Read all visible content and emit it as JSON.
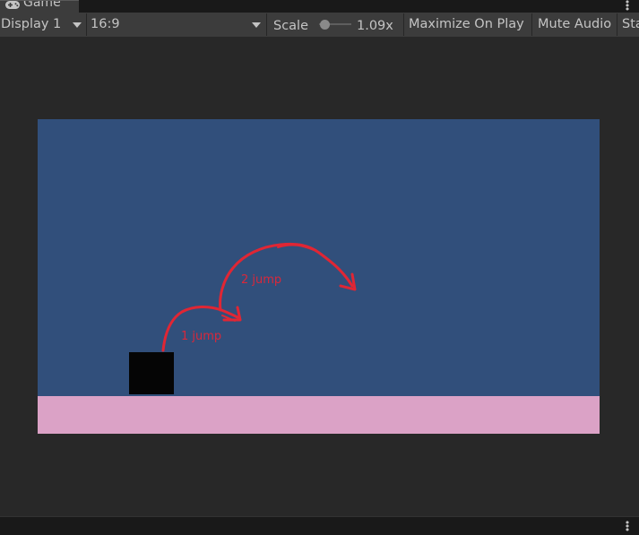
{
  "tab": {
    "title": "Game",
    "icon": "gamepad-icon"
  },
  "toolbar": {
    "display_label": "Display 1",
    "aspect_label": "16:9",
    "scale_label": "Scale",
    "scale_value": "1.09x",
    "scale_level": 0.05,
    "maximize_label": "Maximize On Play",
    "mute_label": "Mute Audio",
    "stats_label": "Stats"
  },
  "game": {
    "background_color": "#314f7b",
    "ground_color": "#dba2c6",
    "player_color": "#050505",
    "annotation_color": "#d8283b",
    "annotation_1": "1 jump",
    "annotation_2": "2 jump"
  },
  "menus": {
    "tab_menu_icon": "more-vertical-icon",
    "footer_menu_icon": "more-vertical-icon"
  }
}
